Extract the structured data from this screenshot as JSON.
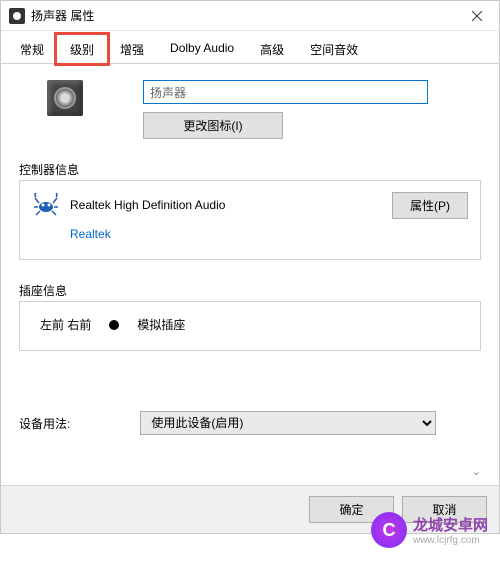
{
  "titlebar": {
    "title": "扬声器 属性"
  },
  "tabs": {
    "items": [
      {
        "label": "常规"
      },
      {
        "label": "级别"
      },
      {
        "label": "增强"
      },
      {
        "label": "Dolby Audio"
      },
      {
        "label": "高级"
      },
      {
        "label": "空间音效"
      }
    ]
  },
  "device": {
    "name_value": "扬声器",
    "change_icon_label": "更改图标(I)"
  },
  "controller": {
    "section_label": "控制器信息",
    "name": "Realtek High Definition Audio",
    "vendor": "Realtek",
    "properties_label": "属性(P)"
  },
  "jack": {
    "section_label": "插座信息",
    "position": "左前 右前",
    "type": "模拟插座"
  },
  "usage": {
    "label": "设备用法:",
    "selected": "使用此设备(启用)"
  },
  "buttons": {
    "ok": "确定",
    "cancel": "取消"
  },
  "watermark": {
    "main": "龙城安卓网",
    "sub": "www.lcjrfg.com"
  }
}
